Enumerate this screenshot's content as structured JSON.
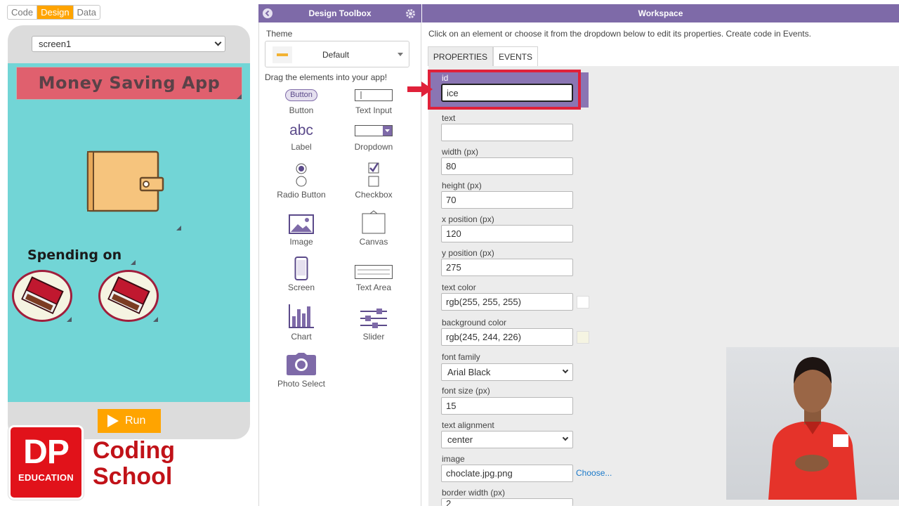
{
  "modes": {
    "code": "Code",
    "design": "Design",
    "data": "Data"
  },
  "preview": {
    "screen_select": "screen1",
    "app_title": "Money Saving App",
    "spending_label": "Spending on",
    "run_label": "Run"
  },
  "logo": {
    "dp": "DP",
    "education": "EDUCATION",
    "line1": "Coding",
    "line2": "School"
  },
  "toolbox": {
    "title": "Design Toolbox",
    "theme_label": "Theme",
    "theme_value": "Default",
    "drag_hint": "Drag the elements into your app!",
    "items": [
      {
        "label": "Button",
        "preview": "Button"
      },
      {
        "label": "Text Input"
      },
      {
        "label": "Label",
        "preview": "abc"
      },
      {
        "label": "Dropdown"
      },
      {
        "label": "Radio Button"
      },
      {
        "label": "Checkbox"
      },
      {
        "label": "Image"
      },
      {
        "label": "Canvas"
      },
      {
        "label": "Screen"
      },
      {
        "label": "Text Area"
      },
      {
        "label": "Chart"
      },
      {
        "label": "Slider"
      },
      {
        "label": "Photo Select"
      }
    ]
  },
  "workspace": {
    "title": "Workspace",
    "hint": "Click on an element or choose it from the dropdown below to edit its properties. Create code in Events.",
    "tabs": {
      "properties": "PROPERTIES",
      "events": "EVENTS"
    },
    "fields": {
      "id": {
        "label": "id",
        "value": "ice"
      },
      "text": {
        "label": "text",
        "value": ""
      },
      "width": {
        "label": "width (px)",
        "value": "80"
      },
      "height": {
        "label": "height (px)",
        "value": "70"
      },
      "x": {
        "label": "x position (px)",
        "value": "120"
      },
      "y": {
        "label": "y position (px)",
        "value": "275"
      },
      "text_color": {
        "label": "text color",
        "value": "rgb(255, 255, 255)"
      },
      "bg_color": {
        "label": "background color",
        "value": "rgb(245, 244, 226)"
      },
      "font_family": {
        "label": "font family",
        "value": "Arial Black"
      },
      "font_size": {
        "label": "font size (px)",
        "value": "15"
      },
      "text_align": {
        "label": "text alignment",
        "value": "center"
      },
      "image": {
        "label": "image",
        "value": "choclate.jpg.png",
        "choose": "Choose..."
      },
      "border_width": {
        "label": "border width (px)",
        "value": "2"
      }
    }
  },
  "colors": {
    "accent": "#7e6aa8",
    "run": "#ffa400",
    "title_bg": "#e0606e",
    "screen_bg": "#72d5d6",
    "highlight": "#e0213a",
    "text_swatch": "#ffffff",
    "bg_swatch": "#f5f4e2"
  }
}
